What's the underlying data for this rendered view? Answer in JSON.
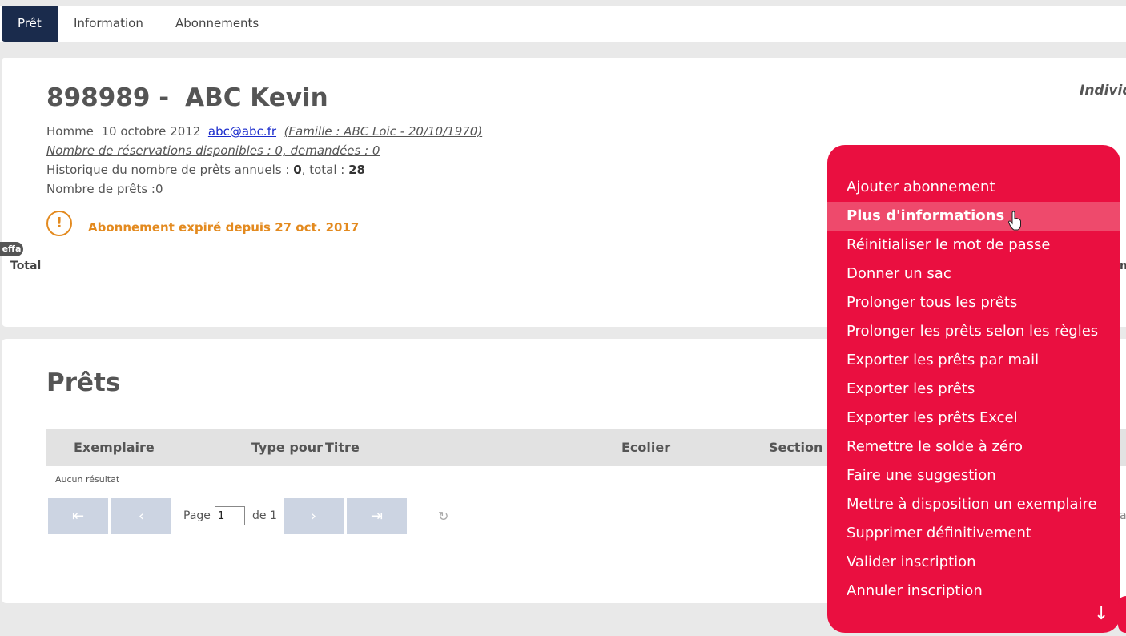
{
  "tabs": [
    {
      "label": "Prêt",
      "active": true
    },
    {
      "label": "Information",
      "active": false
    },
    {
      "label": "Abonnements",
      "active": false
    }
  ],
  "profile": {
    "id": "898989 -",
    "name": "ABC Kevin",
    "type_label": "Individ",
    "gender": "Homme",
    "birthdate": "10 octobre 2012",
    "email": "abc@abc.fr",
    "family": "(Famille : ABC Loic - 20/10/1970)",
    "reservations": "Nombre de réservations disponibles : 0, demandées : 0",
    "history_prefix": "Historique du nombre de prêts annuels : ",
    "history_annual": "0",
    "history_mid": ", total : ",
    "history_total": "28",
    "loan_count": "Nombre de prêts :0",
    "warning": "Abonnement expiré depuis 27 oct. 2017",
    "warning_icon": "!",
    "effa_badge": "effa",
    "total_label": "Total",
    "right_clip": "n"
  },
  "loans": {
    "title": "Prêts",
    "columns": [
      "Exemplaire",
      "Type pour",
      "Titre",
      "Ecolier",
      "Section"
    ],
    "empty_text": "Aucun résultat",
    "pager": {
      "first": "⇤",
      "prev": "‹",
      "page_label": "Page",
      "page_value": "1",
      "of_label": "de 1",
      "next": "›",
      "last": "⇥",
      "refresh": "↻",
      "right_clip": "at"
    }
  },
  "menu": {
    "items": [
      "Ajouter abonnement",
      "Plus d'informations",
      "Réinitialiser le mot de passe",
      "Donner un sac",
      "Prolonger tous les prêts",
      "Prolonger les prêts selon les règles",
      "Exporter les prêts par mail",
      "Exporter les prêts",
      "Exporter les prêts Excel",
      "Remettre le solde à zéro",
      "Faire une suggestion",
      "Mettre à disposition un exemplaire",
      "Supprimer définitivement",
      "Valider inscription",
      "Annuler inscription"
    ],
    "hovered_index": 1,
    "scroll_icon": "↓"
  },
  "colors": {
    "tab_active": "#1a2b4c",
    "menu_bg": "#ea0f40",
    "warning": "#e38a1f"
  }
}
